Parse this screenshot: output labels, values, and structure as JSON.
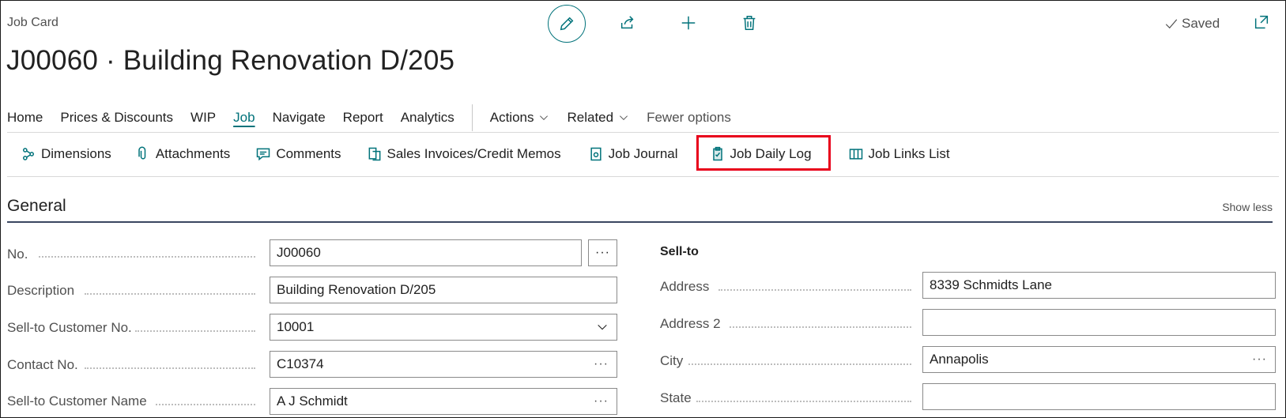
{
  "header": {
    "page_kind": "Job Card",
    "title": "J00060 · Building Renovation D/205",
    "saved_label": "Saved"
  },
  "menu": {
    "items": [
      "Home",
      "Prices & Discounts",
      "WIP",
      "Job",
      "Navigate",
      "Report",
      "Analytics"
    ],
    "active": "Job",
    "actions": "Actions",
    "related": "Related",
    "fewer": "Fewer options"
  },
  "subbar": {
    "items": [
      "Dimensions",
      "Attachments",
      "Comments",
      "Sales Invoices/Credit Memos",
      "Job Journal",
      "Job Daily Log",
      "Job Links List"
    ]
  },
  "section": {
    "title": "General",
    "show_less": "Show less"
  },
  "left_fields": [
    {
      "label": "No.",
      "value": "J00060",
      "control": "assist"
    },
    {
      "label": "Description",
      "value": "Building Renovation D/205",
      "control": "none"
    },
    {
      "label": "Sell-to Customer No.",
      "value": "10001",
      "control": "dropdown"
    },
    {
      "label": "Contact No.",
      "value": "C10374",
      "control": "ellipsis"
    },
    {
      "label": "Sell-to Customer Name",
      "value": "A J Schmidt",
      "control": "ellipsis"
    }
  ],
  "right_group": "Sell-to",
  "right_fields": [
    {
      "label": "Address",
      "value": "8339 Schmidts Lane",
      "control": "none"
    },
    {
      "label": "Address 2",
      "value": "",
      "control": "none"
    },
    {
      "label": "City",
      "value": "Annapolis",
      "control": "ellipsis"
    },
    {
      "label": "State",
      "value": "",
      "control": "none"
    }
  ],
  "colors": {
    "accent": "#00727a",
    "highlight": "#e8001b"
  }
}
